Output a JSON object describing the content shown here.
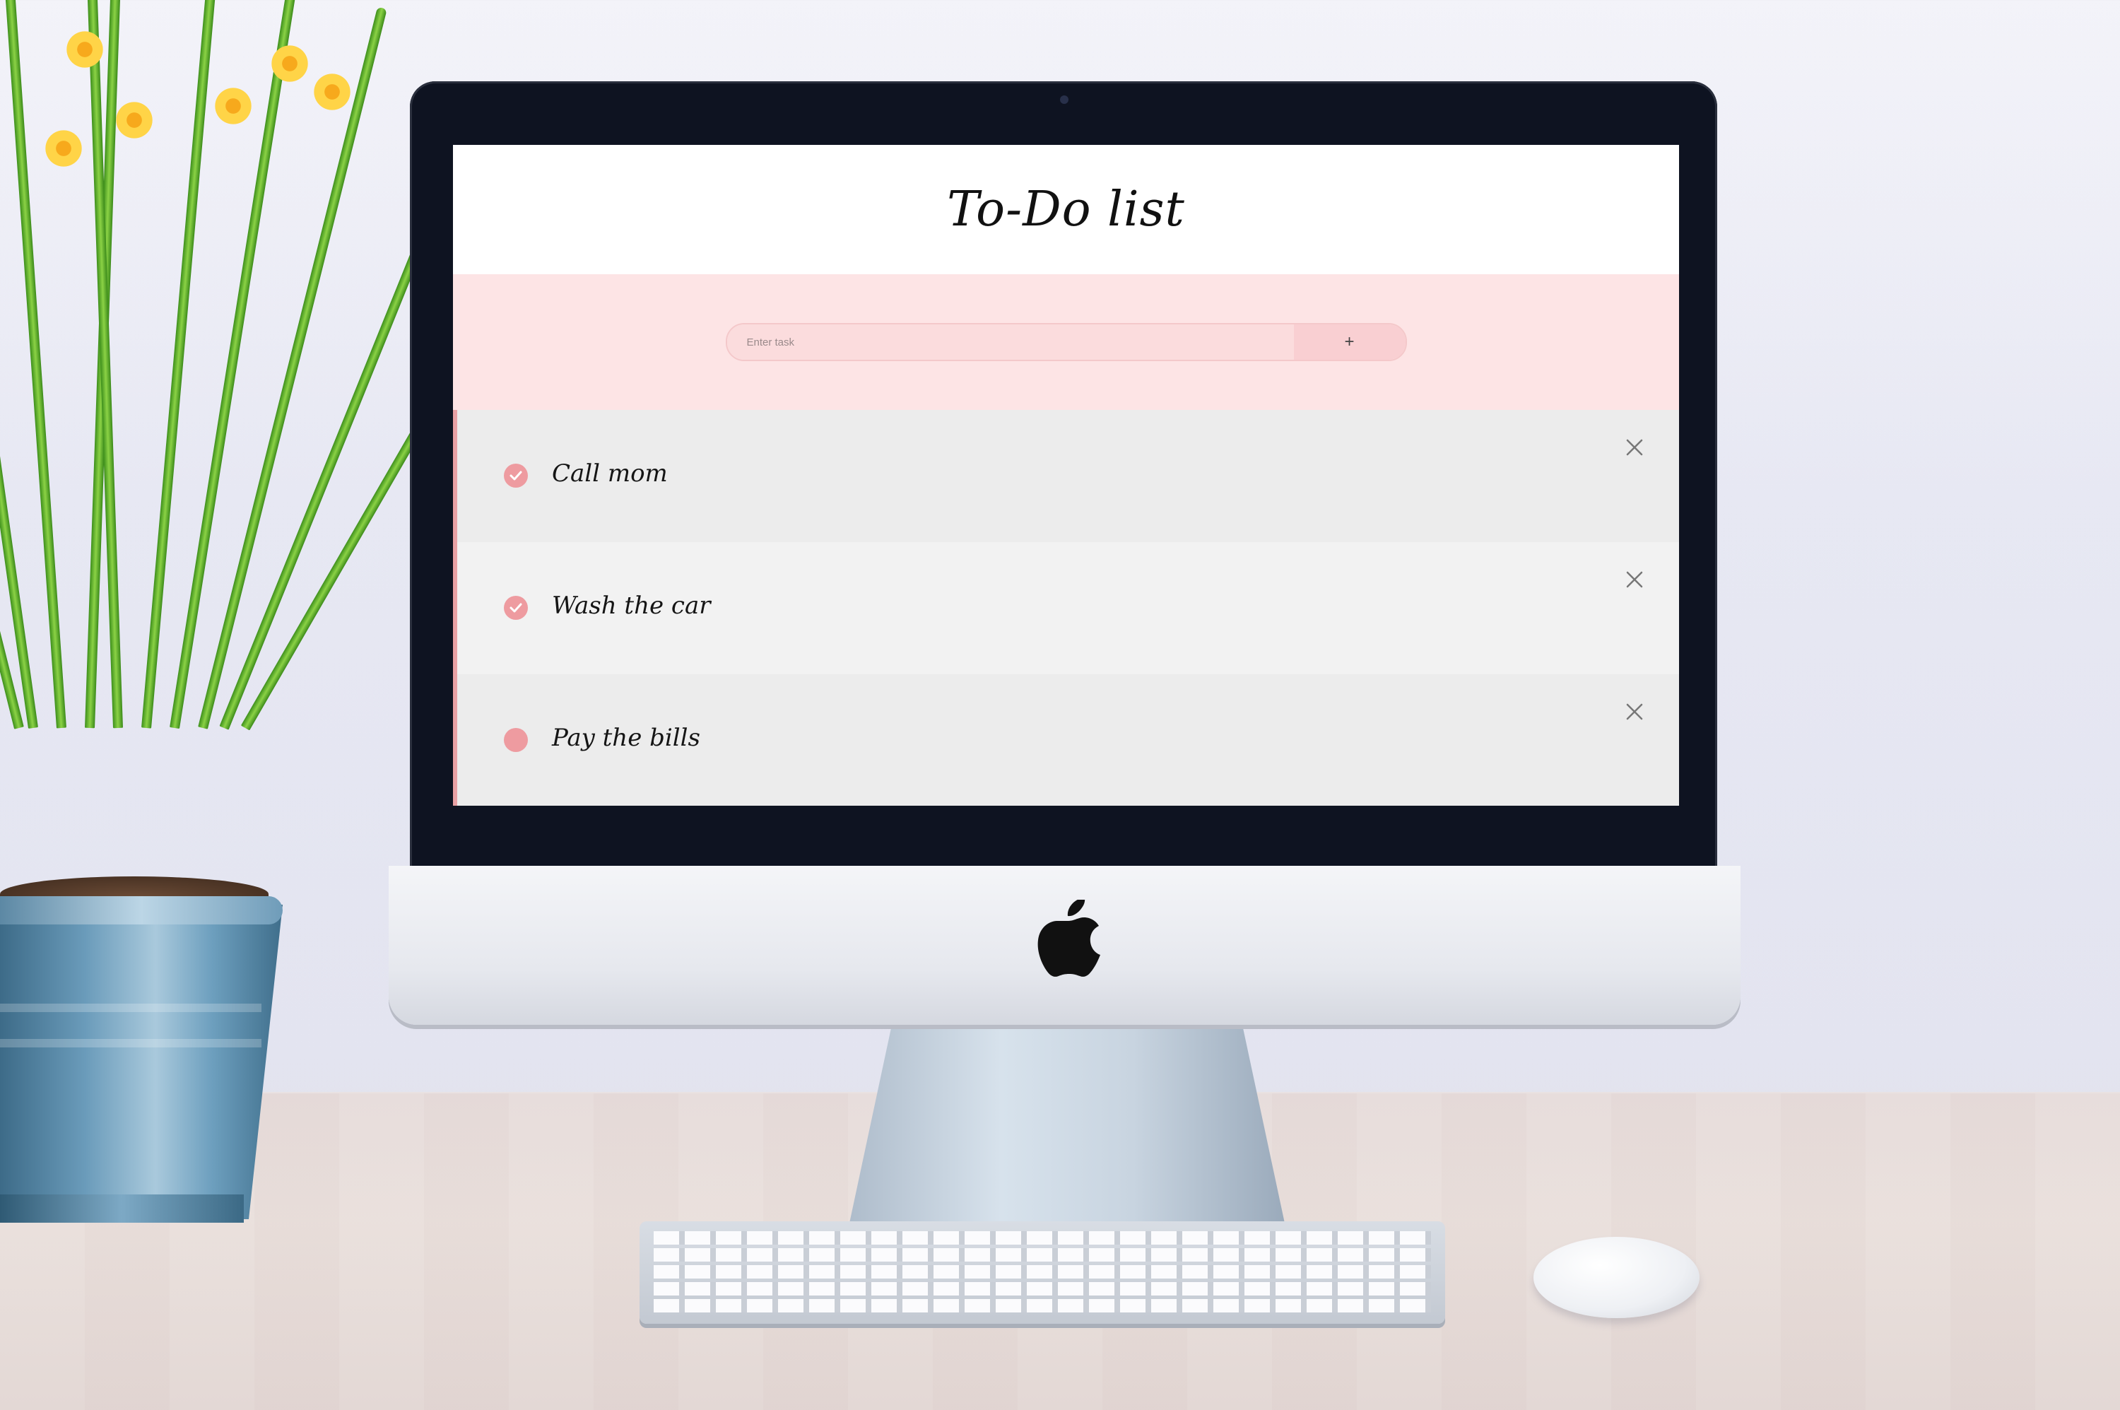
{
  "app": {
    "title": "To-Do list",
    "input": {
      "placeholder": "Enter task",
      "value": ""
    },
    "add_button_label": "+",
    "tasks": [
      {
        "text": "Call mom",
        "completed": true
      },
      {
        "text": "Wash the car",
        "completed": true
      },
      {
        "text": "Pay the bills",
        "completed": false
      }
    ]
  },
  "colors": {
    "accent": "#ee9ba0",
    "input_band": "#fde4e5",
    "item_border": "#e8a1a4"
  },
  "icons": {
    "check": "check-icon",
    "delete": "close-icon",
    "add": "plus-icon",
    "brand": "apple-logo-icon"
  }
}
